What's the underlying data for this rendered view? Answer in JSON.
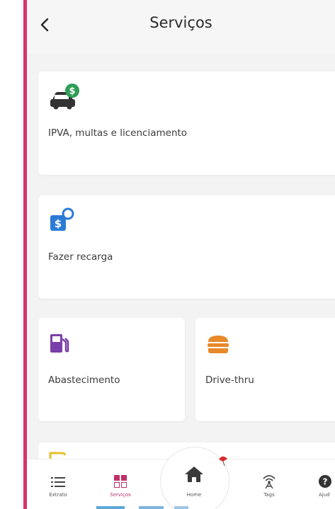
{
  "header": {
    "title": "Serviços"
  },
  "cards": {
    "ipva": {
      "label": "IPVA, multas e licenciamento",
      "icon": "car-with-dollar-icon"
    },
    "recarga": {
      "label": "Fazer recarga",
      "icon": "dollar-recharge-icon"
    },
    "abastecimento": {
      "label": "Abastecimento",
      "icon": "fuel-pump-icon"
    },
    "drivethru": {
      "label": "Drive-thru",
      "icon": "burger-icon"
    }
  },
  "nav": {
    "extrato": "Extrato",
    "servicos": "Serviços",
    "home": "Home",
    "tags": "Tags",
    "ajuda": "Ajud"
  },
  "colors": {
    "accent": "#d9326a",
    "icon_green": "#2e9e57",
    "icon_blue": "#2b7bd6",
    "icon_purple": "#7a3fa8",
    "icon_orange": "#e8892a"
  }
}
